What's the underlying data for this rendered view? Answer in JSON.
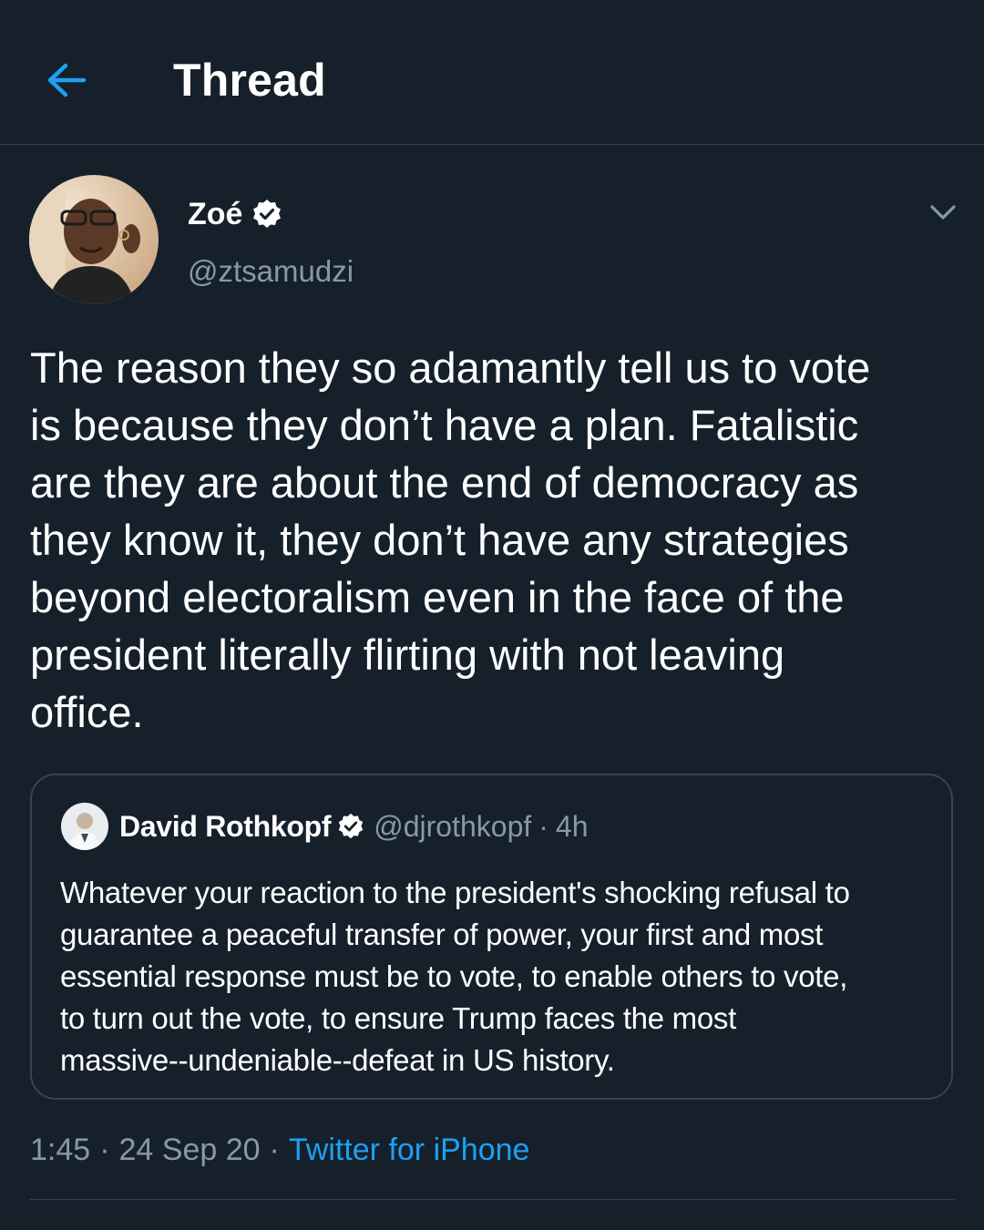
{
  "header": {
    "title": "Thread",
    "back_icon": "arrow-left-icon",
    "accent_color": "#1da1f2"
  },
  "tweet": {
    "author_name": "Zoé",
    "author_handle": "@ztsamudzi",
    "verified_icon": "verified-badge-icon",
    "menu_icon": "chevron-down-icon",
    "text": "The reason they so adamantly tell us to vote\nis because they don’t have a plan. Fatalistic\nare they are about the end of democracy as\nthey know it, they don’t have any strategies\nbeyond electoralism even in the face of the\npresident literally flirting with not leaving\noffice.",
    "time": "1:45",
    "date": "24 Sep 20",
    "separator": "·",
    "source": "Twitter for iPhone"
  },
  "quoted_tweet": {
    "author_name": "David Rothkopf",
    "author_handle": "@djrothkopf",
    "separator": "·",
    "time_ago": "4h",
    "verified_icon": "verified-badge-icon",
    "text": "Whatever your reaction to the president's shocking refusal to\nguarantee a peaceful transfer of power, your first and most\nessential response must be to vote, to enable others to vote,\nto turn out the vote, to ensure Trump faces the most\nmassive--undeniable--defeat in US history."
  },
  "colors": {
    "background": "#15202b",
    "border": "#38444d",
    "secondary_text": "#8899a6",
    "link": "#1da1f2"
  }
}
